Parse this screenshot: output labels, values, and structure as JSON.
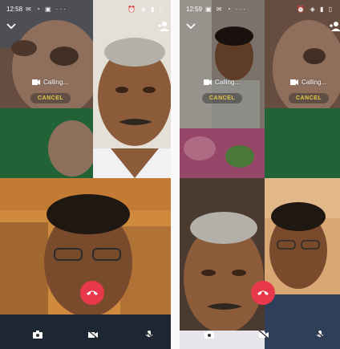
{
  "screens": [
    {
      "status_time": "12:58",
      "status_left": "✉ ◔ ▣ ···",
      "status_right": "⏰ ◈ ▮ ▯",
      "calling_text": "Calling...",
      "cancel_label": "CANCEL",
      "calling_text_2": "",
      "cancel_label_2": ""
    },
    {
      "status_time": "12:59",
      "status_left": "▣ ✉ ◔ ···",
      "status_right": "⏰ ◈ ▮ ▯",
      "calling_text": "Calling...",
      "cancel_label": "CANCEL",
      "calling_text_2": "Calling...",
      "cancel_label_2": "CANCEL"
    }
  ],
  "icons": {
    "collapse": "chevron-down-icon",
    "add_participant": "add-person-icon",
    "video": "video-camera-icon",
    "end_call": "phone-hangup-icon",
    "switch_camera": "camera-switch-icon",
    "video_off": "video-off-icon",
    "mute": "mic-off-icon"
  },
  "colors": {
    "end_call": "#e8384b",
    "cancel_text": "#e6c64a"
  }
}
